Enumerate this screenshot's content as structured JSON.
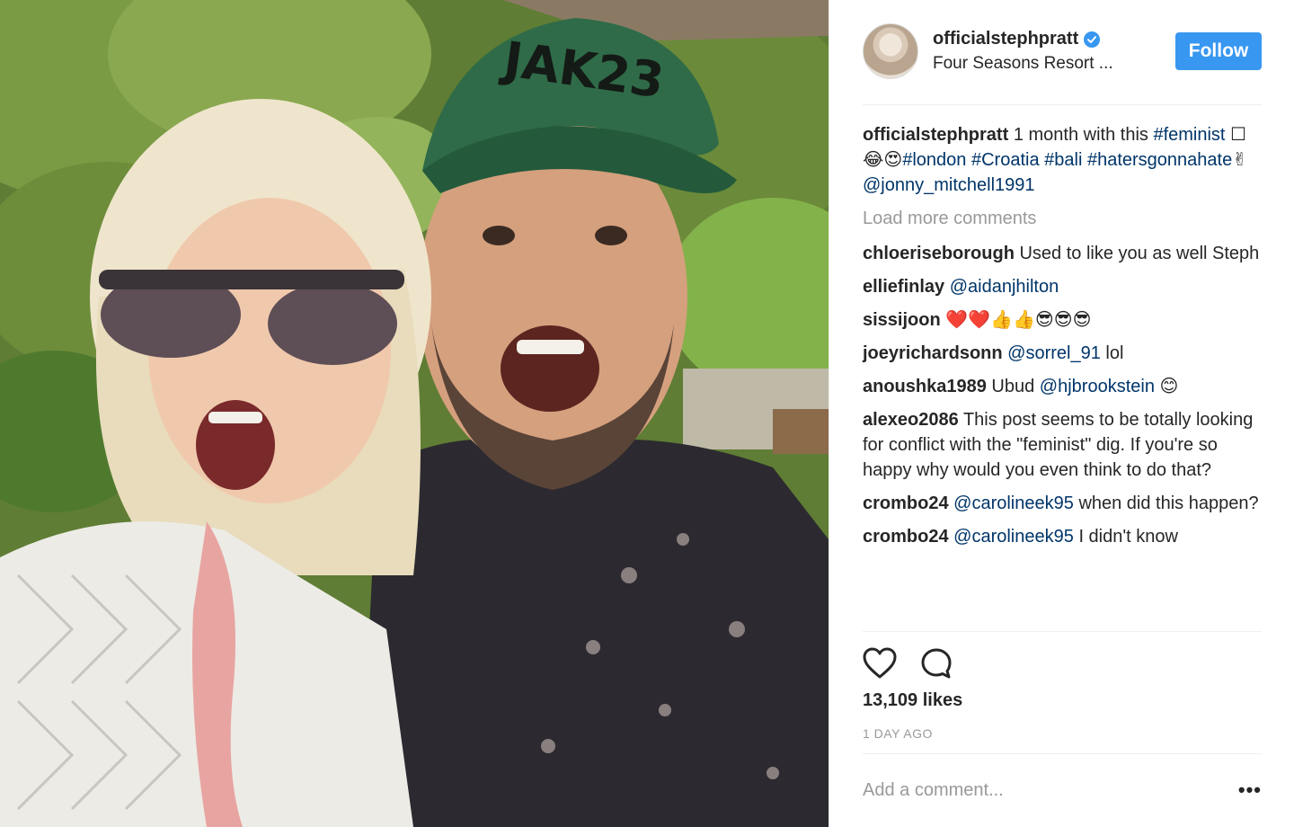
{
  "photo": {
    "cap_text": "JAK23"
  },
  "header": {
    "username": "officialstephpratt",
    "location": "Four Seasons Resort ...",
    "follow_label": "Follow"
  },
  "caption": {
    "username": "officialstephpratt",
    "text_1": "1 month with this",
    "tag_feminist": "#feminist",
    "emoji_1": "☐😂😍",
    "tag_london": "#london",
    "tag_croatia": "#Croatia",
    "tag_bali": "#bali",
    "tag_haters": "#hatersgonnahate",
    "emoji_2": "✌",
    "mention": "@jonny_mitchell1991"
  },
  "load_more": "Load more comments",
  "comments": [
    {
      "user": "chloeriseborough",
      "text": "Used to like you as well Steph"
    },
    {
      "user": "elliefinlay",
      "mention": "@aidanjhilton"
    },
    {
      "user": "sissijoon",
      "text": "❤️❤️👍👍😎😎😎"
    },
    {
      "user": "joeyrichardsonn",
      "mention": "@sorrel_91",
      "text": "lol"
    },
    {
      "user": "anoushka1989",
      "text": "Ubud",
      "mention": "@hjbrookstein",
      "text_after": "😊"
    },
    {
      "user": "alexeo2086",
      "text": "This post seems to be totally looking for conflict with the \"feminist\" dig. If you're so happy why would you even think to do that?"
    },
    {
      "user": "crombo24",
      "mention": "@carolineek95",
      "text": "when did this happen?"
    },
    {
      "user": "crombo24",
      "mention": "@carolineek95",
      "text": "I didn't know"
    }
  ],
  "likes": "13,109 likes",
  "date": "1 DAY AGO",
  "add_comment_placeholder": "Add a comment...",
  "more_options": "•••",
  "icons": {
    "heart": "heart-icon",
    "comment": "comment-icon",
    "verified": "verified-badge-icon"
  },
  "colors": {
    "follow_button": "#3897f0",
    "link": "#003569",
    "muted": "#999999"
  }
}
